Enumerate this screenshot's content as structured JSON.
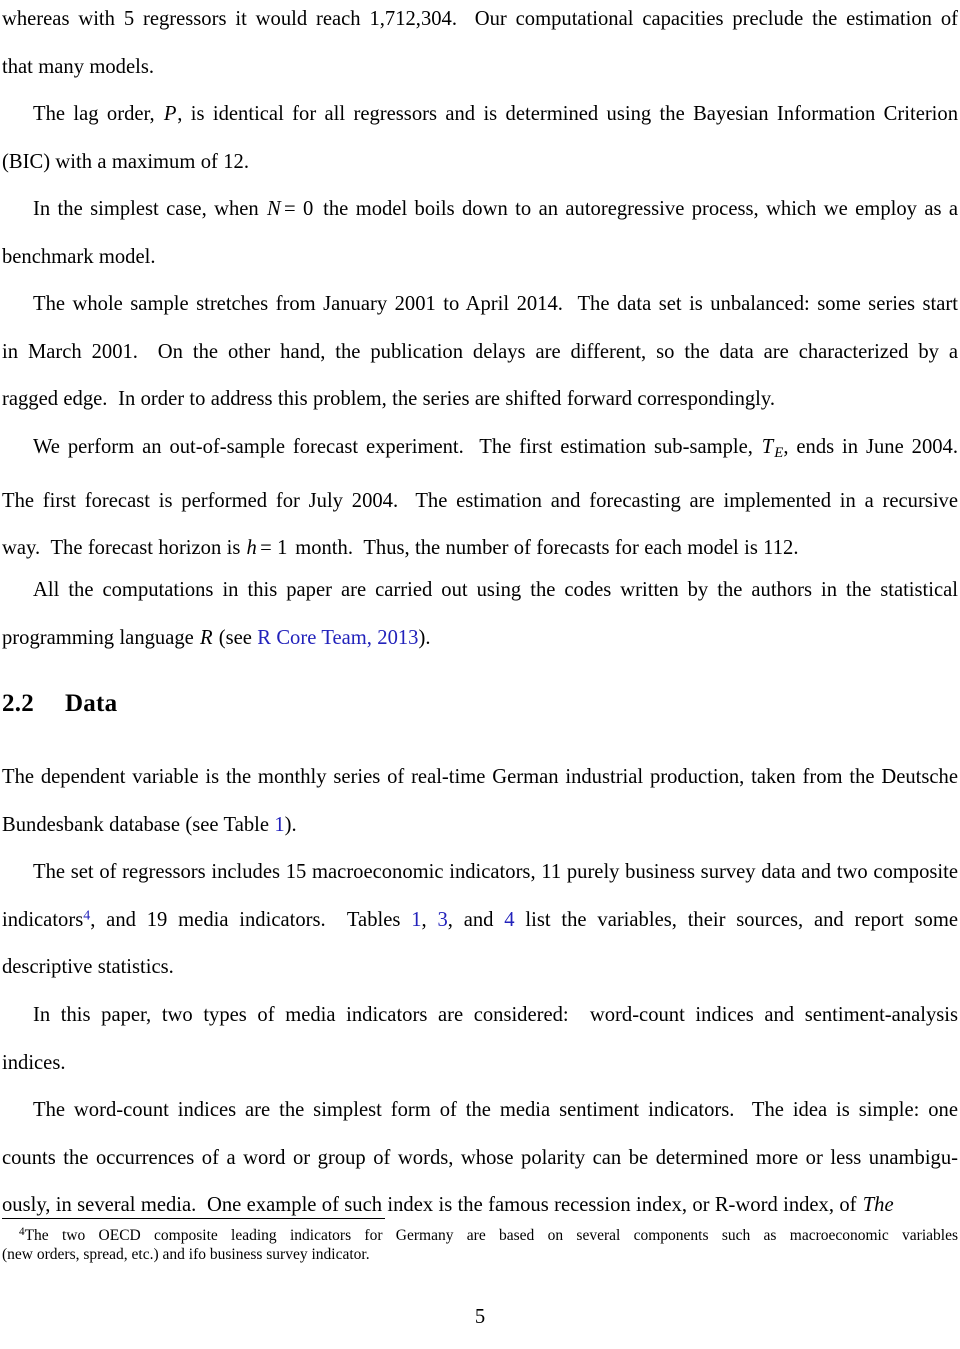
{
  "document": {
    "type": "academic-paper-page",
    "page_number": "5",
    "link_color": "#2222bb",
    "text_color": "#000000",
    "background_color": "#ffffff"
  },
  "body": {
    "paragraphs": [
      {
        "id": "para-continuation",
        "indent": false,
        "lines": [
          "whereas with 5 regressors it would reach 1,712,304.  Our computational capacities preclude the estimation of",
          "that many models."
        ]
      },
      {
        "id": "para-lag-order",
        "indent": true,
        "lines": [
          "The lag order, P, is identical for all regressors and is determined using the Bayesian Information Criterion",
          "(BIC) with a maximum of 12."
        ]
      },
      {
        "id": "para-simplest-case",
        "indent": true,
        "lines": [
          "In the simplest case, when N = 0 the model boils down to an autoregressive process, which we employ as a",
          "benchmark model."
        ]
      },
      {
        "id": "para-sample",
        "indent": true,
        "lines": [
          "The whole sample stretches from January 2001 to April 2014.  The data set is unbalanced: some series start",
          "in March 2001.  On the other hand, the publication delays are different, so the data are characterized by a",
          "ragged edge.  In order to address this problem, the series are shifted forward correspondingly."
        ]
      },
      {
        "id": "para-forecast-experiment",
        "indent": true,
        "lines": [
          "We perform an out-of-sample forecast experiment.  The first estimation sub-sample, TE, ends in June 2004.",
          "The first forecast is performed for July 2004.  The estimation and forecasting are implemented in a recursive",
          "way.  The forecast horizon is h = 1 month.  Thus, the number of forecasts for each model is 112."
        ]
      },
      {
        "id": "para-computations",
        "indent": true,
        "lines": [
          "All the computations in this paper are carried out using the codes written by the authors in the statistical",
          "programming language R (see R Core Team, 2013)."
        ]
      }
    ],
    "section": {
      "number": "2.2",
      "title": "Data"
    },
    "paragraphs_after_section": [
      {
        "id": "para-dependent-variable",
        "indent": false,
        "lines": [
          "The dependent variable is the monthly series of real-time German industrial production, taken from the Deutsche",
          "Bundesbank database (see Table 1)."
        ]
      },
      {
        "id": "para-regressors",
        "indent": true,
        "lines": [
          "The set of regressors includes 15 macroeconomic indicators, 11 purely business survey data and two composite",
          "indicators4, and 19 media indicators.  Tables 1, 3, and 4 list the variables, their sources, and report some",
          "descriptive statistics."
        ]
      },
      {
        "id": "para-two-types",
        "indent": true,
        "lines": [
          "In this paper, two types of media indicators are considered:  word-count indices and sentiment-analysis",
          "indices."
        ]
      },
      {
        "id": "para-word-count",
        "indent": true,
        "lines": [
          "The word-count indices are the simplest form of the media sentiment indicators.  The idea is simple: one",
          "counts the occurrences of a word or group of words, whose polarity can be determined more or less unambigu-",
          "ously, in several media.  One example of such index is the famous recession index, or R-word index, of The"
        ]
      }
    ]
  },
  "inline": {
    "math_P": "P",
    "math_N": "N",
    "math_N_eq": "= 0",
    "math_T": "T",
    "math_T_sub": "E",
    "math_h": "h",
    "math_h_eq": "= 1",
    "math_R": "R",
    "italic_the": "The"
  },
  "links": {
    "r_core_team": "R Core Team, 2013",
    "table_1_first": "1",
    "table_1": "1",
    "table_3": "3",
    "table_4": "4",
    "footnote_marker": "4"
  },
  "footnote": {
    "marker": "4",
    "lines": [
      "The two OECD composite leading indicators for Germany are based on several components such as macroeconomic variables",
      "(new orders, spread, etc.) and ifo business survey indicator."
    ]
  }
}
